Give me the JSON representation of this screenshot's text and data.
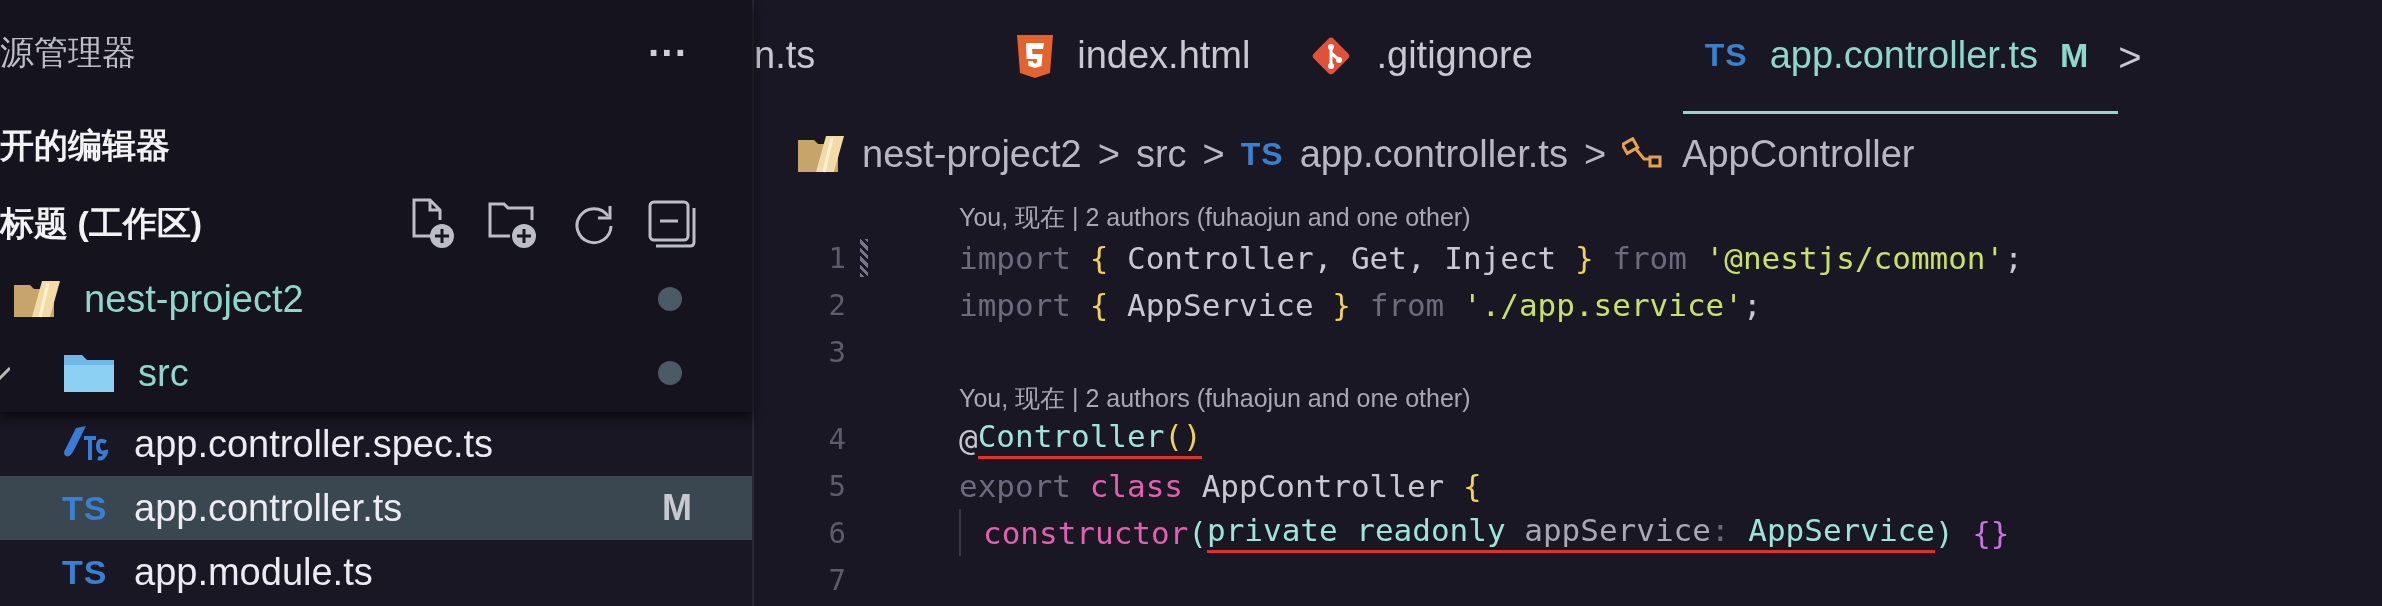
{
  "sidebar": {
    "title": "源管理器",
    "more": "···",
    "open_editors": {
      "title": "开的编辑器"
    },
    "workspace": {
      "title": "标题 (工作区)",
      "actions": [
        {
          "kind": "new-file"
        },
        {
          "kind": "new-folder"
        },
        {
          "kind": "refresh"
        },
        {
          "kind": "collapse"
        }
      ]
    },
    "tree": [
      {
        "name": "nest-project2",
        "kind": "open-folder",
        "expanded": true,
        "modified_dot": true,
        "children": [
          {
            "name": "src",
            "kind": "folder",
            "expanded": true,
            "modified_dot": true,
            "children": [
              {
                "name": "app.controller.spec.ts",
                "kind": "ts-spec",
                "selected": false
              },
              {
                "name": "app.controller.ts",
                "kind": "ts",
                "icon_text": "TS",
                "selected": true,
                "badge": "M"
              },
              {
                "name": "app.module.ts",
                "kind": "ts",
                "icon_text": "TS",
                "selected": false
              }
            ]
          }
        ]
      }
    ]
  },
  "tabs": [
    {
      "label": "n.ts",
      "kind": "plain",
      "selected": false
    },
    {
      "label": "index.html",
      "kind": "html",
      "selected": false
    },
    {
      "label": ".gitignore",
      "kind": "git",
      "selected": false
    },
    {
      "label": "app.controller.ts",
      "kind": "ts",
      "icon_text": "TS",
      "selected": true,
      "badge": "M"
    }
  ],
  "tab_scroll": ">",
  "breadcrumb": [
    {
      "label": "nest-project2",
      "kind": "open-folder"
    },
    {
      "label": "src",
      "kind": "plain"
    },
    {
      "label": "app.controller.ts",
      "kind": "ts",
      "icon_text": "TS"
    },
    {
      "label": "AppController",
      "kind": "class"
    }
  ],
  "breadcrumb_separator": ">",
  "editor": {
    "lines": [
      {
        "kind": "codelens",
        "text": "You, 现在 | 2 authors (fuhaojun and one other)"
      },
      {
        "kind": "code",
        "number": "1",
        "git_modified": true,
        "tokens": [
          {
            "text": "import ",
            "kind": "dim"
          },
          {
            "text": "{",
            "kind": "brace"
          },
          {
            "text": " Controller, Get, Inject ",
            "kind": "plain"
          },
          {
            "text": "}",
            "kind": "brace"
          },
          {
            "text": " from ",
            "kind": "dim"
          },
          {
            "text": "'@nestjs/common'",
            "kind": "string"
          },
          {
            "text": ";",
            "kind": "plain"
          }
        ]
      },
      {
        "kind": "code",
        "number": "2",
        "tokens": [
          {
            "text": "import ",
            "kind": "dim"
          },
          {
            "text": "{",
            "kind": "brace"
          },
          {
            "text": " AppService ",
            "kind": "plain"
          },
          {
            "text": "}",
            "kind": "brace"
          },
          {
            "text": " from ",
            "kind": "dim"
          },
          {
            "text": "'./app.service'",
            "kind": "string"
          },
          {
            "text": ";",
            "kind": "plain"
          }
        ]
      },
      {
        "kind": "code",
        "number": "3"
      },
      {
        "kind": "codelens",
        "text": "You, 现在 | 2 authors (fuhaojun and one other)"
      },
      {
        "kind": "code",
        "number": "4",
        "tokens": [
          {
            "text": "@",
            "kind": "plain"
          },
          {
            "text": "Controller",
            "kind": "type",
            "underlined": true
          },
          {
            "text": "()",
            "kind": "brace",
            "underlined": true
          }
        ]
      },
      {
        "kind": "code",
        "number": "5",
        "tokens": [
          {
            "text": "export ",
            "kind": "dim"
          },
          {
            "text": "class",
            "kind": "keyword"
          },
          {
            "text": " AppController ",
            "kind": "plain"
          },
          {
            "text": "{",
            "kind": "brace"
          }
        ]
      },
      {
        "kind": "code",
        "number": "6",
        "indented": true,
        "tokens": [
          {
            "text": "constructor",
            "kind": "keyword"
          },
          {
            "text": "(",
            "kind": "type"
          },
          {
            "text": "private readonly ",
            "kind": "type",
            "underlined": true
          },
          {
            "text": "appService",
            "kind": "param",
            "underlined": true
          },
          {
            "text": ": ",
            "kind": "dim",
            "underlined": true
          },
          {
            "text": "AppService",
            "kind": "type",
            "underlined": true
          },
          {
            "text": ")",
            "kind": "type"
          },
          {
            "text": " {}",
            "kind": "purple"
          }
        ]
      },
      {
        "kind": "code",
        "number": "7"
      }
    ]
  }
}
